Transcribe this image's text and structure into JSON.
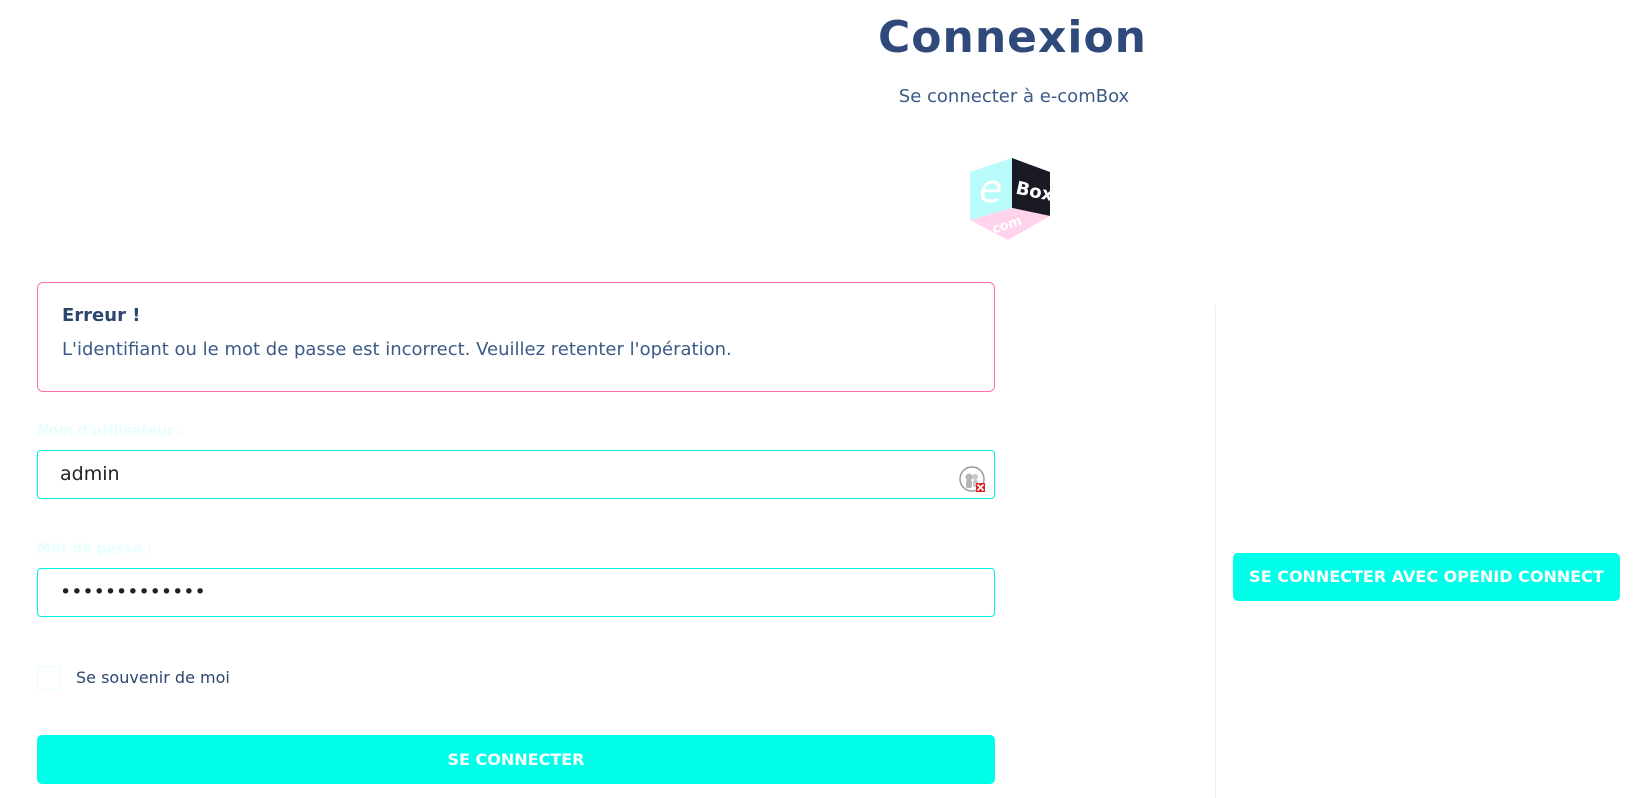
{
  "header": {
    "title": "Connexion",
    "subtitle": "Se connecter à e-comBox"
  },
  "logo": {
    "letter_e": "e",
    "text_box": "Box",
    "text_com": "com",
    "colors": {
      "cyan": "#b9fbfb",
      "pink": "#ffd3ec",
      "dark": "#1a1a24"
    }
  },
  "alert": {
    "title": "Erreur !",
    "message": "L'identifiant ou le mot de passe est incorrect. Veuillez retenter l'opération.",
    "border_color": "#ff6fb0"
  },
  "form": {
    "username_label": "Nom d'utilisateur :",
    "username_value": "admin",
    "password_label": "Mot de passe :",
    "password_value": "•••••••••••••",
    "remember_label": "Se souvenir de moi",
    "submit_label": "SE CONNECTER"
  },
  "side": {
    "openid_label": "SE CONNECTER AVEC OPENID CONNECT"
  },
  "colors": {
    "accent": "#00ffe9",
    "title": "#2f4a7a",
    "text": "#3b5a86"
  },
  "icons": {
    "password_manager": "password-manager-icon"
  }
}
